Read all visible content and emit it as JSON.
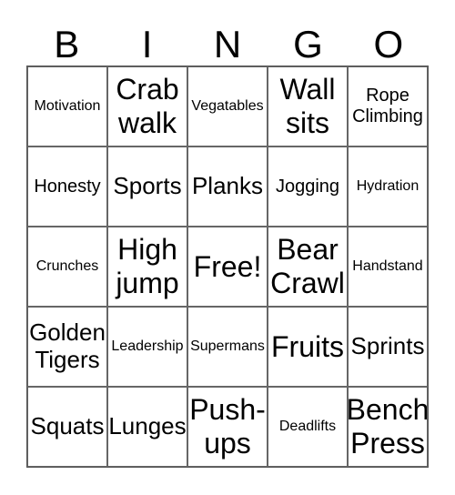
{
  "header": {
    "letters": [
      "B",
      "I",
      "N",
      "G",
      "O"
    ]
  },
  "cells": [
    [
      "Motivation",
      "Crab walk",
      "Vegatables",
      "Wall sits",
      "Rope Climbing"
    ],
    [
      "Honesty",
      "Sports",
      "Planks",
      "Jogging",
      "Hydration"
    ],
    [
      "Crunches",
      "High jump",
      "Free!",
      "Bear Crawl",
      "Handstand"
    ],
    [
      "Golden Tigers",
      "Leadership",
      "Supermans",
      "Fruits",
      "Sprints"
    ],
    [
      "Squats",
      "Lunges",
      "Push-ups",
      "Deadlifts",
      "Bench Press"
    ]
  ]
}
